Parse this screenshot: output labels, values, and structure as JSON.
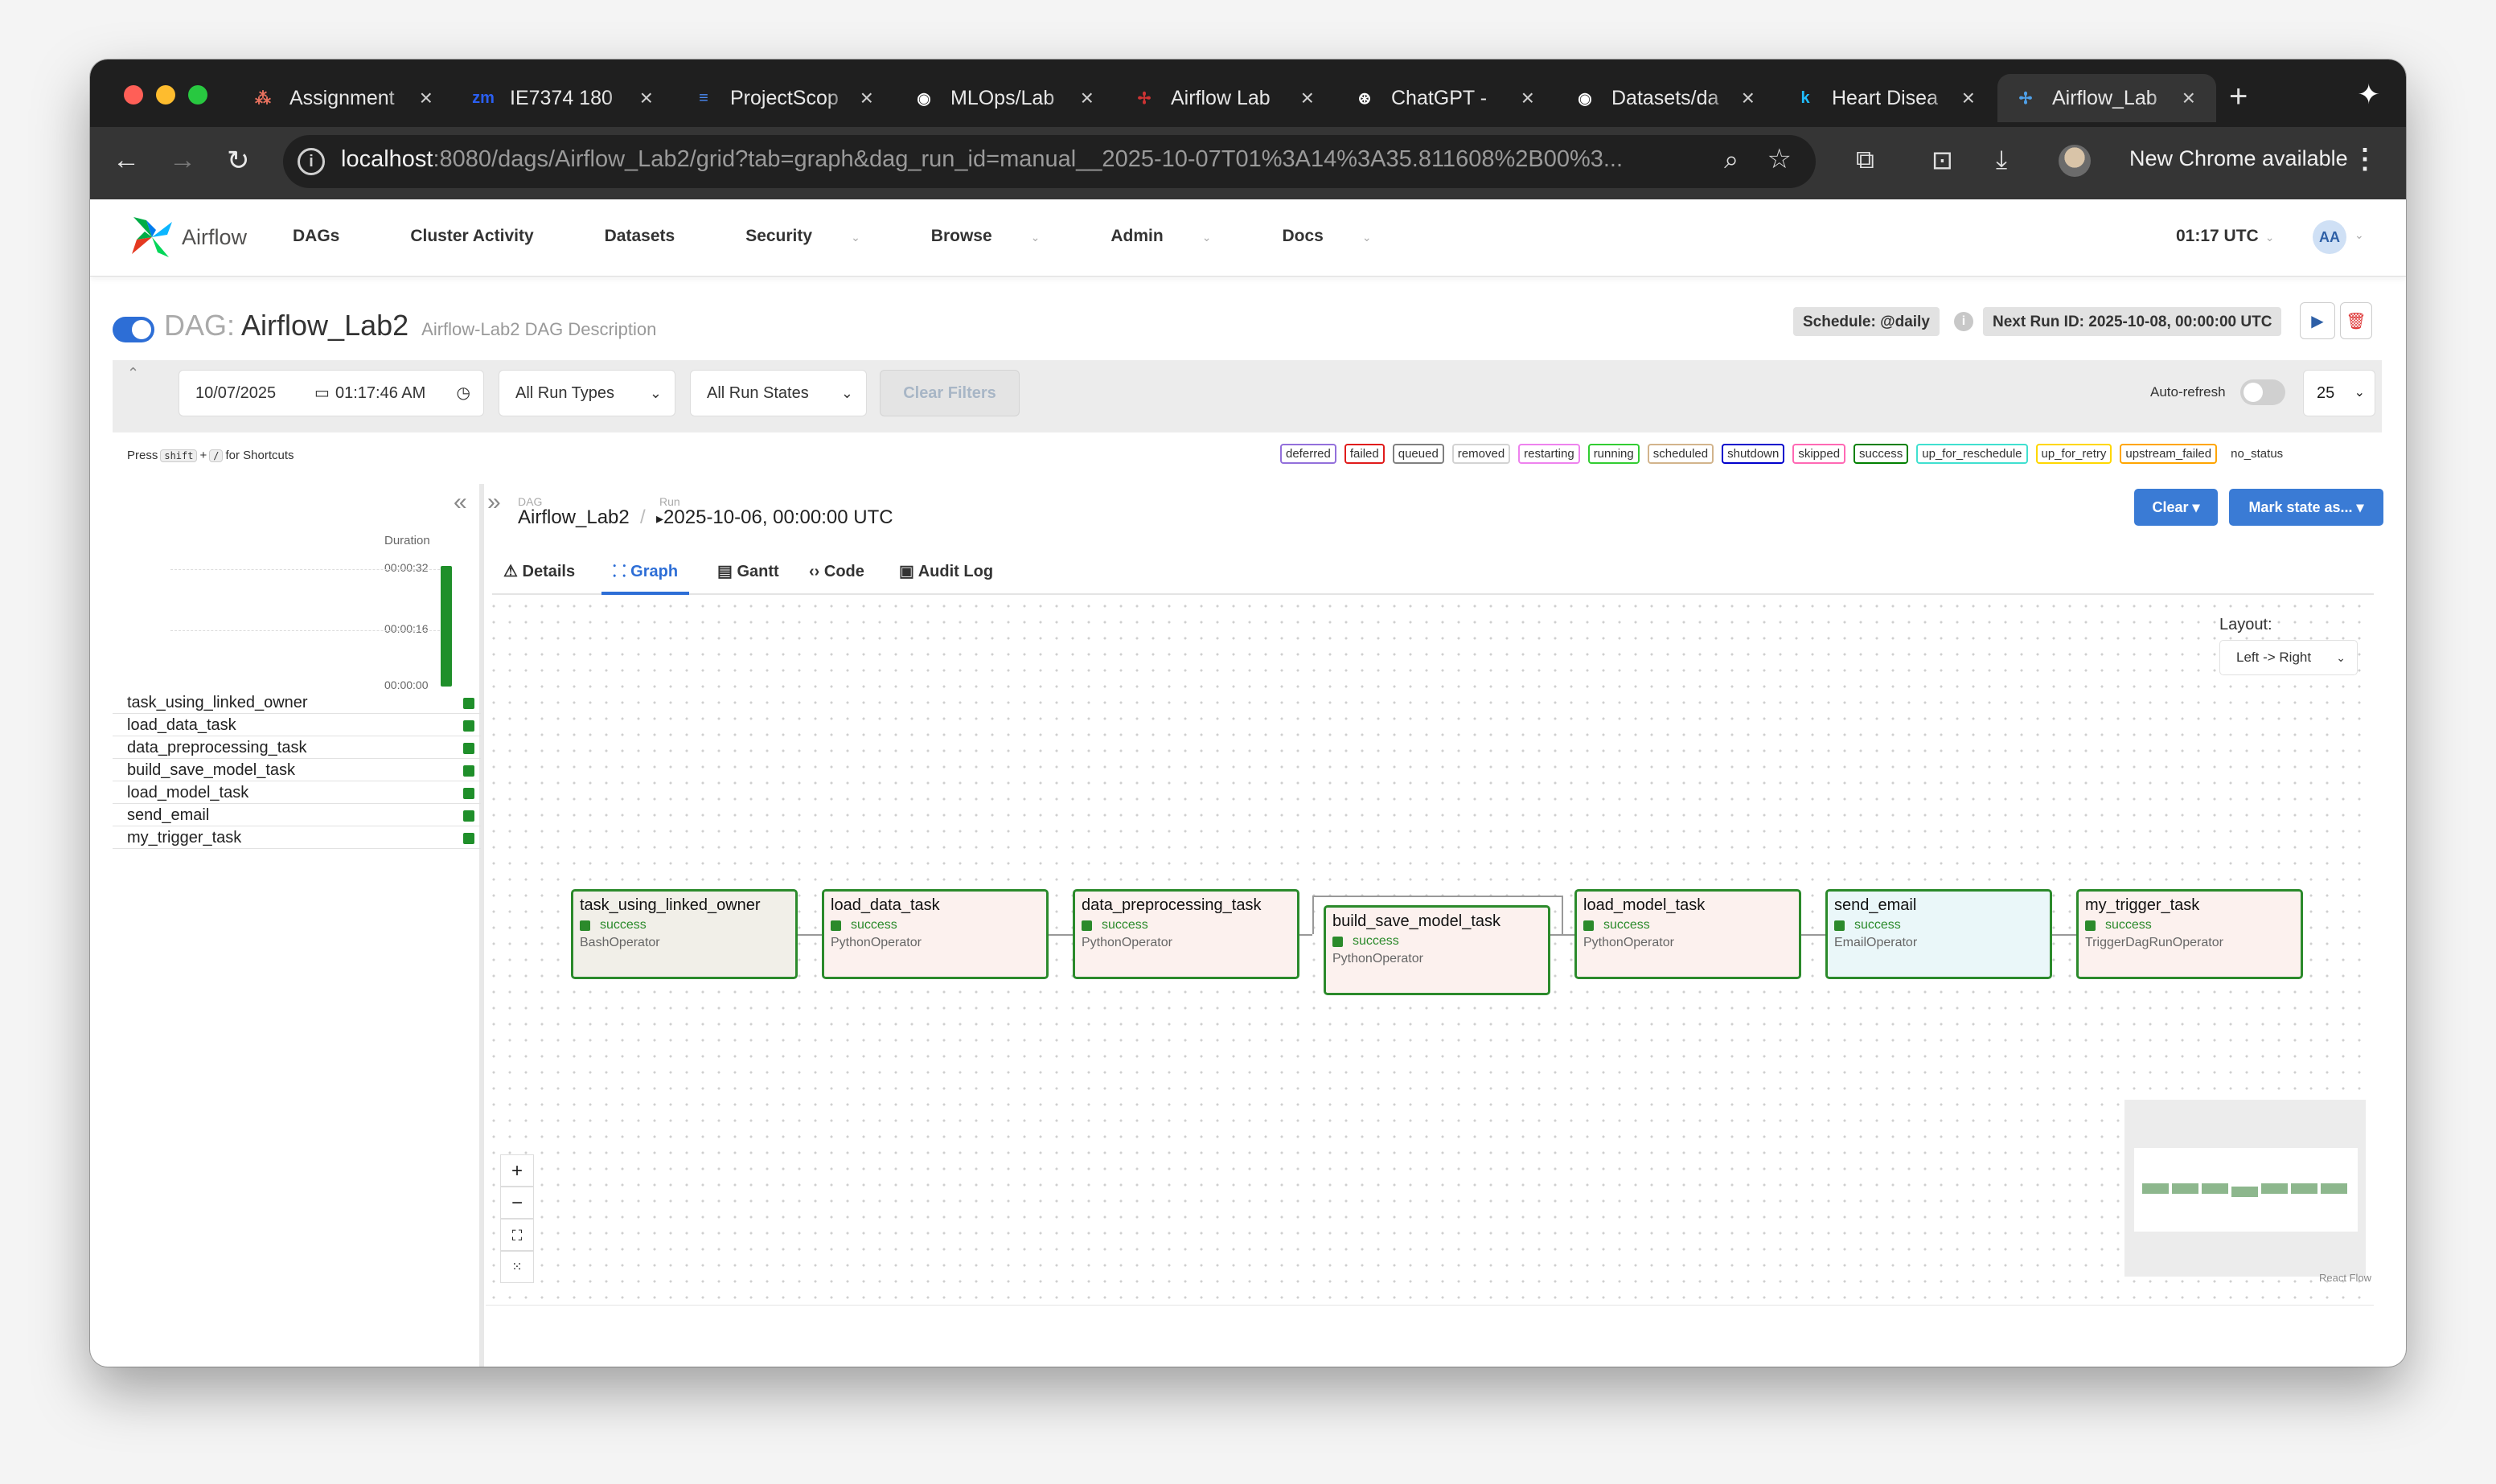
{
  "browser": {
    "tabs": [
      {
        "title": "Assignment",
        "icon": "asana-icon",
        "color": "#e8715e"
      },
      {
        "title": "IE7374 180",
        "icon": "zoom-icon",
        "color": "#2b5ff1"
      },
      {
        "title": "ProjectScop",
        "icon": "google-docs-icon",
        "color": "#4a8af4"
      },
      {
        "title": "MLOps/Lab",
        "icon": "github-icon",
        "color": "#ffffff"
      },
      {
        "title": "Airflow Lab",
        "icon": "airflow-icon",
        "color": "#cc3333"
      },
      {
        "title": "ChatGPT -",
        "icon": "chatgpt-icon",
        "color": "#ffffff"
      },
      {
        "title": "Datasets/da",
        "icon": "github-icon",
        "color": "#ffffff"
      },
      {
        "title": "Heart Disea",
        "icon": "kaggle-icon",
        "color": "#20beff"
      },
      {
        "title": "Airflow_Lab",
        "icon": "airflow-icon",
        "color": "#4fa0e8"
      }
    ],
    "url_host": "localhost",
    "url_rest": ":8080/dags/Airflow_Lab2/grid?tab=graph&dag_run_id=manual__2025-10-07T01%3A14%3A35.811608%2B00%3...",
    "new_chrome": "New Chrome available"
  },
  "airflow": {
    "brand": "Airflow",
    "menu": [
      "DAGs",
      "Cluster Activity",
      "Datasets",
      "Security",
      "Browse",
      "Admin",
      "Docs"
    ],
    "time": "01:17 UTC",
    "user_initials": "AA"
  },
  "dag": {
    "prefix": "DAG:",
    "name": "Airflow_Lab2",
    "description": "Airflow-Lab2 DAG Description",
    "schedule": "Schedule: @daily",
    "next_run": "Next Run ID: 2025-10-08, 00:00:00 UTC"
  },
  "filters": {
    "date": "10/07/2025",
    "time": "01:17:46 AM",
    "run_types": "All Run Types",
    "run_states": "All Run States",
    "clear_filters": "Clear Filters",
    "auto_refresh": "Auto-refresh",
    "page_size": "25"
  },
  "shortcuts": {
    "press": "Press",
    "key1": "shift",
    "plus": "+",
    "key2": "/",
    "suffix": "for Shortcuts"
  },
  "legend": [
    {
      "label": "deferred",
      "color": "#9370db"
    },
    {
      "label": "failed",
      "color": "#e01b1b"
    },
    {
      "label": "queued",
      "color": "#808080"
    },
    {
      "label": "removed",
      "color": "#d3d3d3"
    },
    {
      "label": "restarting",
      "color": "#ee82ee"
    },
    {
      "label": "running",
      "color": "#32cd32"
    },
    {
      "label": "scheduled",
      "color": "#d2b48c"
    },
    {
      "label": "shutdown",
      "color": "#0000cc"
    },
    {
      "label": "skipped",
      "color": "#ff69b4"
    },
    {
      "label": "success",
      "color": "#008000"
    },
    {
      "label": "up_for_reschedule",
      "color": "#40e0d0"
    },
    {
      "label": "up_for_retry",
      "color": "#ffd700"
    },
    {
      "label": "upstream_failed",
      "color": "#ffa500"
    },
    {
      "label": "no_status",
      "color": "#ffffff"
    }
  ],
  "grid": {
    "duration_label": "Duration",
    "ticks": [
      "00:00:32",
      "00:00:16",
      "00:00:00"
    ],
    "tasks": [
      "task_using_linked_owner",
      "load_data_task",
      "data_preprocessing_task",
      "build_save_model_task",
      "load_model_task",
      "send_email",
      "my_trigger_task"
    ]
  },
  "detail": {
    "dag_label": "DAG",
    "dag_value": "Airflow_Lab2",
    "run_label": "Run",
    "run_value": "2025-10-06, 00:00:00 UTC",
    "clear_btn": "Clear",
    "mark_btn": "Mark state as...",
    "tabs": [
      "Details",
      "Graph",
      "Gantt",
      "Code",
      "Audit Log"
    ],
    "layout_label": "Layout:",
    "layout_value": "Left -> Right",
    "react_flow": "React Flow"
  },
  "nodes": [
    {
      "name": "task_using_linked_owner",
      "state": "success",
      "operator": "BashOperator",
      "bg": "#f1efe8"
    },
    {
      "name": "load_data_task",
      "state": "success",
      "operator": "PythonOperator",
      "bg": "#fcf1ee"
    },
    {
      "name": "data_preprocessing_task",
      "state": "success",
      "operator": "PythonOperator",
      "bg": "#fcf1ee"
    },
    {
      "name": "build_save_model_task",
      "state": "success",
      "operator": "PythonOperator",
      "bg": "#fcf1ee"
    },
    {
      "name": "load_model_task",
      "state": "success",
      "operator": "PythonOperator",
      "bg": "#fcf1ee"
    },
    {
      "name": "send_email",
      "state": "success",
      "operator": "EmailOperator",
      "bg": "#eaf7f9"
    },
    {
      "name": "my_trigger_task",
      "state": "success",
      "operator": "TriggerDagRunOperator",
      "bg": "#fcf1ee"
    }
  ]
}
